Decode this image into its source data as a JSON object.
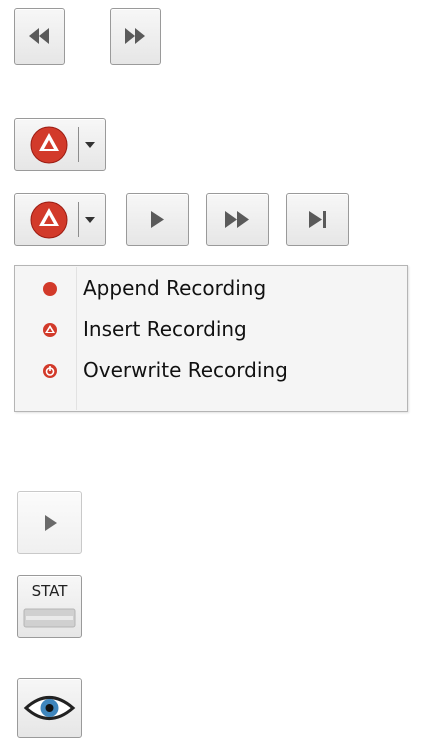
{
  "record_menu": {
    "items": [
      {
        "label": "Append Recording",
        "icon": "append-recording-icon"
      },
      {
        "label": "Insert Recording",
        "icon": "insert-recording-icon"
      },
      {
        "label": "Overwrite Recording",
        "icon": "overwrite-recording-icon"
      }
    ]
  },
  "stat_button": {
    "label": "STAT"
  },
  "colors": {
    "record_red": "#d23a2a",
    "glyph_gray": "#5a5a5a",
    "eye_blue": "#3f86bd"
  }
}
